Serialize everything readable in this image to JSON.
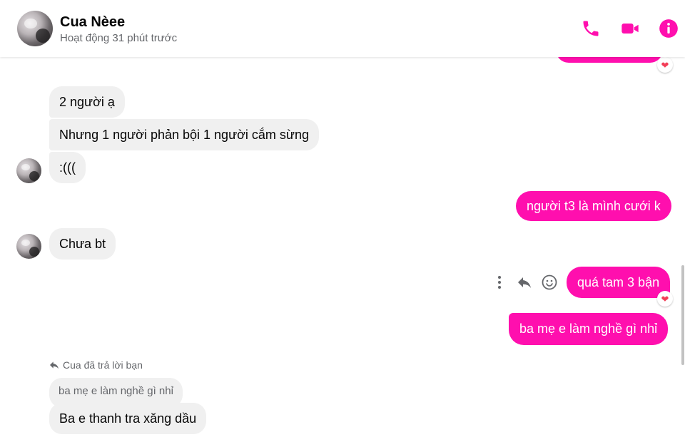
{
  "header": {
    "name": "Cua Nèee",
    "status": "Hoạt động 31 phút trước",
    "icons": [
      "phone-icon",
      "video-camera-icon",
      "info-icon"
    ],
    "accent_color": "#ff0fae"
  },
  "messages": {
    "in_1": "2 người ạ",
    "in_2": "Nhưng 1 người phản bội 1 người cắm sừng",
    "in_3": ":(((",
    "in_4": "Chưa bt",
    "out_1": "người t3 là mình cưới k",
    "out_2": "quá tam 3 bận",
    "out_3": "ba mẹ e làm nghề gì nhỉ",
    "reply_label": "Cua đã trả lời bạn",
    "quoted": "ba mẹ e làm nghề gì nhỉ",
    "in_5": "Ba e thanh tra xăng dầu"
  },
  "reactions": [
    "heart",
    "heart"
  ],
  "message_actions": [
    "more-icon",
    "reply-icon",
    "emoji-icon"
  ],
  "colors": {
    "outgoing_bubble": "#ff0fae",
    "incoming_bubble": "#f0f0f0",
    "reaction_heart": "#f33e58"
  }
}
